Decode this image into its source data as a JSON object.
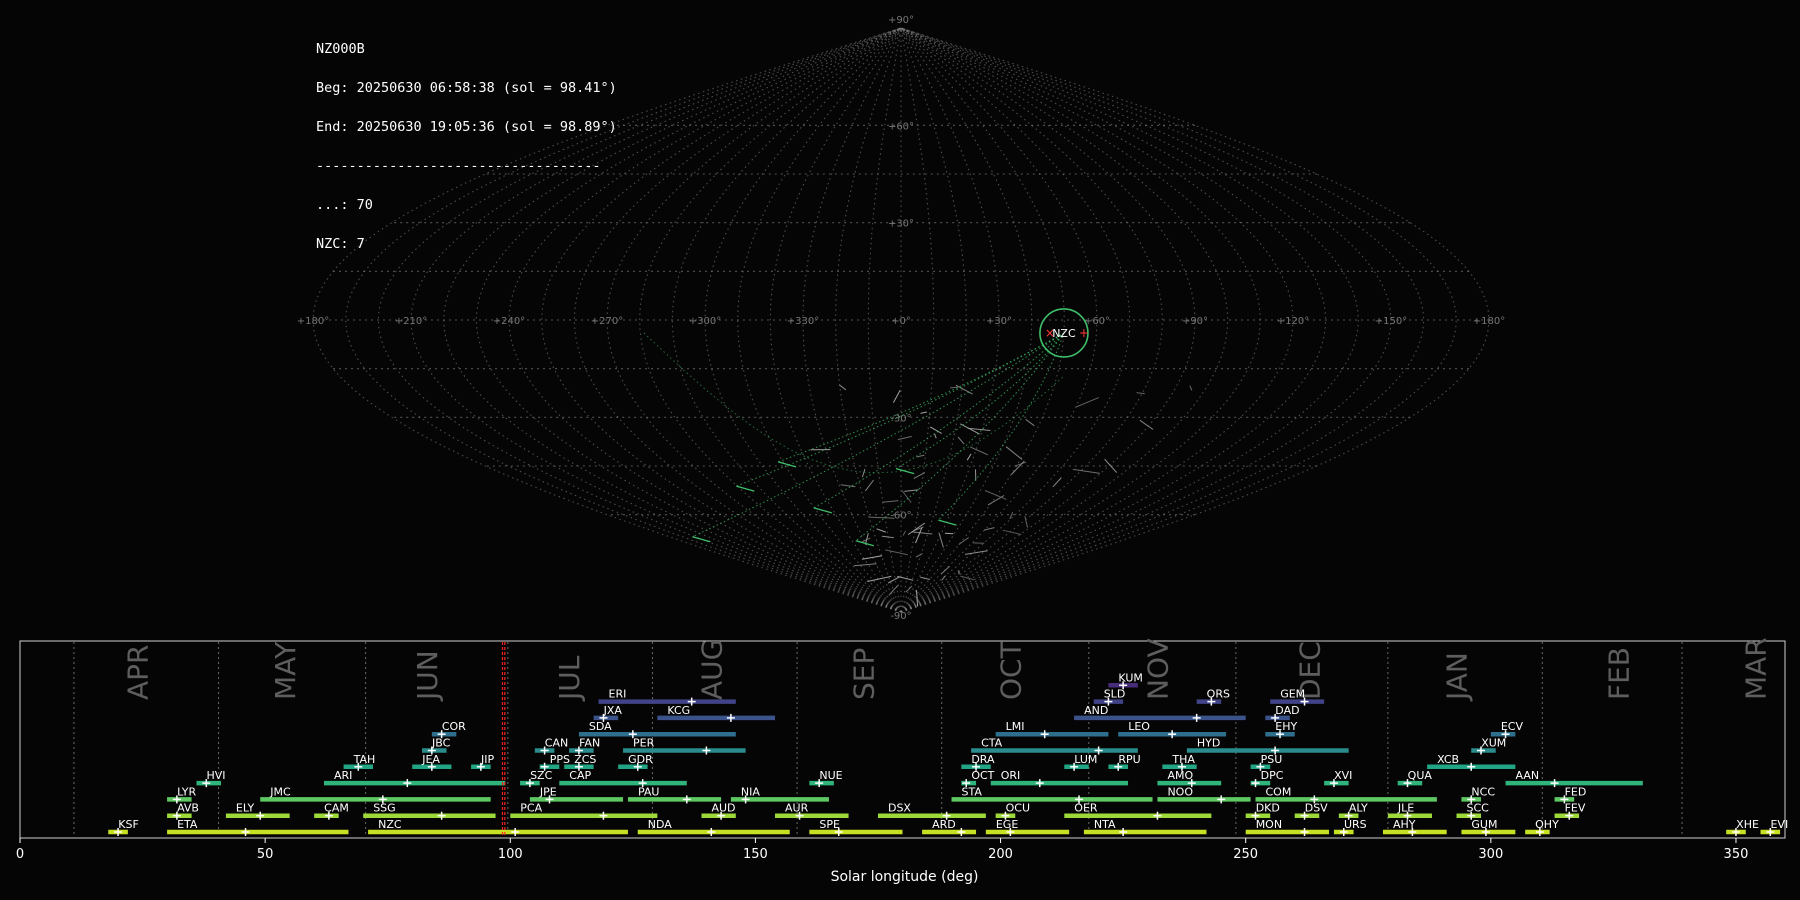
{
  "info": {
    "station": "NZ000B",
    "beg": "Beg: 20250630 06:58:38 (sol = 98.41°)",
    "end": "End: 20250630 19:05:36 (sol = 98.89°)",
    "separator": "-----------------------------------",
    "sporadic": "...: 70",
    "shower_count": "NZC: 7"
  },
  "colors": {
    "background": "#050505",
    "grid": "#888888",
    "radiant_circle": "#3fbf6a",
    "radiant_marker": "#ff3b3b",
    "solar_line": "#ff2020"
  },
  "chart_data": [
    {
      "type": "sky-map",
      "projection": "sinusoidal",
      "longitude_tick_labels": [
        "+180°",
        "+150°",
        "+120°",
        "+90°",
        "+60°",
        "+30°",
        "+0°",
        "+330°",
        "+300°",
        "+270°",
        "+240°",
        "+210°",
        "+180°"
      ],
      "latitude_tick_labels": [
        "+90°",
        "+60°",
        "+30°",
        "-30°",
        "-60°",
        "-90°"
      ],
      "active_radiant": {
        "name": "NZC",
        "lon_offset_deg": -50,
        "lat_deg": -4
      },
      "meteor_count_sporadic": 70,
      "meteor_count_shower": 7
    },
    {
      "type": "timeline",
      "xlabel": "Solar longitude (deg)",
      "xlim": [
        0,
        360
      ],
      "xticks": [
        0,
        50,
        100,
        150,
        200,
        250,
        300,
        350
      ],
      "current_sol": [
        98.41,
        98.89
      ],
      "months": [
        {
          "name": "APR",
          "at": 24
        },
        {
          "name": "MAY",
          "at": 54
        },
        {
          "name": "JUN",
          "at": 83
        },
        {
          "name": "JUL",
          "at": 112
        },
        {
          "name": "AUG",
          "at": 141
        },
        {
          "name": "SEP",
          "at": 172
        },
        {
          "name": "OCT",
          "at": 202
        },
        {
          "name": "NOV",
          "at": 232
        },
        {
          "name": "DEC",
          "at": 263
        },
        {
          "name": "JAN",
          "at": 293
        },
        {
          "name": "FEB",
          "at": 326
        },
        {
          "name": "MAR",
          "at": 354
        }
      ],
      "month_boundaries": [
        11,
        40.5,
        70.5,
        99.5,
        129,
        158.5,
        188,
        218,
        248,
        279,
        310.5,
        339
      ],
      "showers": [
        {
          "name": "KUM",
          "start": 222,
          "end": 228,
          "peak": 225,
          "row": 9
        },
        {
          "name": "ERI",
          "start": 118,
          "end": 146,
          "peak": 137,
          "row": 8
        },
        {
          "name": "SLD",
          "start": 219,
          "end": 225,
          "peak": 222,
          "row": 8
        },
        {
          "name": "ORS",
          "start": 240,
          "end": 245,
          "peak": 243,
          "row": 8
        },
        {
          "name": "GEM",
          "start": 255,
          "end": 266,
          "peak": 262,
          "row": 8
        },
        {
          "name": "JXA",
          "start": 117,
          "end": 122,
          "peak": 119,
          "row": 7
        },
        {
          "name": "KCG",
          "start": 130,
          "end": 154,
          "peak": 145,
          "row": 7
        },
        {
          "name": "AND",
          "start": 215,
          "end": 250,
          "peak": 240,
          "row": 7
        },
        {
          "name": "DAD",
          "start": 254,
          "end": 259,
          "peak": 256,
          "row": 7
        },
        {
          "name": "COR",
          "start": 84,
          "end": 89,
          "peak": 86,
          "row": 6
        },
        {
          "name": "SDA",
          "start": 114,
          "end": 146,
          "peak": 125,
          "row": 6
        },
        {
          "name": "LMI",
          "start": 199,
          "end": 222,
          "peak": 209,
          "row": 6
        },
        {
          "name": "LEO",
          "start": 224,
          "end": 246,
          "peak": 235,
          "row": 6
        },
        {
          "name": "EHY",
          "start": 254,
          "end": 260,
          "peak": 257,
          "row": 6
        },
        {
          "name": "ECV",
          "start": 300,
          "end": 305,
          "peak": 303,
          "row": 6
        },
        {
          "name": "JBC",
          "start": 82,
          "end": 87,
          "peak": 84,
          "row": 5
        },
        {
          "name": "CAN",
          "start": 105,
          "end": 109,
          "peak": 107,
          "row": 5
        },
        {
          "name": "FAN",
          "start": 112,
          "end": 117,
          "peak": 114,
          "row": 5
        },
        {
          "name": "PER",
          "start": 123,
          "end": 148,
          "peak": 140,
          "row": 5
        },
        {
          "name": "CTA",
          "start": 194,
          "end": 228,
          "peak": 220,
          "row": 5
        },
        {
          "name": "HYD",
          "start": 238,
          "end": 271,
          "peak": 256,
          "row": 5
        },
        {
          "name": "XUM",
          "start": 296,
          "end": 301,
          "peak": 298,
          "row": 5
        },
        {
          "name": "TAH",
          "start": 66,
          "end": 72,
          "peak": 69,
          "row": 4
        },
        {
          "name": "JEA",
          "start": 80,
          "end": 88,
          "peak": 84,
          "row": 4
        },
        {
          "name": "JIP",
          "start": 92,
          "end": 96,
          "peak": 94,
          "row": 4
        },
        {
          "name": "PPS",
          "start": 106,
          "end": 110,
          "peak": 107,
          "row": 4
        },
        {
          "name": "ZCS",
          "start": 111,
          "end": 117,
          "peak": 114,
          "row": 4
        },
        {
          "name": "GDR",
          "start": 122,
          "end": 128,
          "peak": 126,
          "row": 4
        },
        {
          "name": "DRA",
          "start": 192,
          "end": 198,
          "peak": 195,
          "row": 4
        },
        {
          "name": "LUM",
          "start": 213,
          "end": 218,
          "peak": 215,
          "row": 4
        },
        {
          "name": "RPU",
          "start": 222,
          "end": 226,
          "peak": 224,
          "row": 4
        },
        {
          "name": "THA",
          "start": 233,
          "end": 240,
          "peak": 237,
          "row": 4
        },
        {
          "name": "PSU",
          "start": 251,
          "end": 255,
          "peak": 253,
          "row": 4
        },
        {
          "name": "XCB",
          "start": 287,
          "end": 305,
          "peak": 296,
          "row": 4
        },
        {
          "name": "HVI",
          "start": 36,
          "end": 41,
          "peak": 38,
          "row": 3
        },
        {
          "name": "ARI",
          "start": 62,
          "end": 99,
          "peak": 79,
          "row": 3
        },
        {
          "name": "SZC",
          "start": 102,
          "end": 106,
          "peak": 104,
          "row": 3
        },
        {
          "name": "CAP",
          "start": 110,
          "end": 136,
          "peak": 127,
          "row": 3
        },
        {
          "name": "NUE",
          "start": 161,
          "end": 166,
          "peak": 163,
          "row": 3
        },
        {
          "name": "OCT",
          "start": 192,
          "end": 195,
          "peak": 193,
          "row": 3
        },
        {
          "name": "ORI",
          "start": 198,
          "end": 226,
          "peak": 208,
          "row": 3
        },
        {
          "name": "AMO",
          "start": 232,
          "end": 245,
          "peak": 239,
          "row": 3
        },
        {
          "name": "DPC",
          "start": 251,
          "end": 255,
          "peak": 252,
          "row": 3
        },
        {
          "name": "XVI",
          "start": 266,
          "end": 271,
          "peak": 268,
          "row": 3
        },
        {
          "name": "QUA",
          "start": 281,
          "end": 286,
          "peak": 283,
          "row": 3
        },
        {
          "name": "AAN",
          "start": 303,
          "end": 331,
          "peak": 313,
          "row": 3
        },
        {
          "name": "LYR",
          "start": 30,
          "end": 35,
          "peak": 32,
          "row": 2
        },
        {
          "name": "JMC",
          "start": 49,
          "end": 96,
          "peak": 74,
          "row": 2
        },
        {
          "name": "JPE",
          "start": 104,
          "end": 123,
          "peak": 108,
          "row": 2
        },
        {
          "name": "PAU",
          "start": 124,
          "end": 143,
          "peak": 136,
          "row": 2
        },
        {
          "name": "NIA",
          "start": 145,
          "end": 165,
          "peak": 148,
          "row": 2
        },
        {
          "name": "STA",
          "start": 190,
          "end": 231,
          "peak": 216,
          "row": 2
        },
        {
          "name": "NOO",
          "start": 232,
          "end": 251,
          "peak": 245,
          "row": 2
        },
        {
          "name": "COM",
          "start": 252,
          "end": 289,
          "peak": 264,
          "row": 2
        },
        {
          "name": "NCC",
          "start": 294,
          "end": 298,
          "peak": 296,
          "row": 2
        },
        {
          "name": "FED",
          "start": 313,
          "end": 317,
          "peak": 315,
          "row": 2
        },
        {
          "name": "AVB",
          "start": 30,
          "end": 35,
          "peak": 32,
          "row": 1
        },
        {
          "name": "ELY",
          "start": 42,
          "end": 55,
          "peak": 49,
          "row": 1
        },
        {
          "name": "CAM",
          "start": 60,
          "end": 65,
          "peak": 63,
          "row": 1
        },
        {
          "name": "SSG",
          "start": 70,
          "end": 97,
          "peak": 86,
          "row": 1
        },
        {
          "name": "PCA",
          "start": 100,
          "end": 130,
          "peak": 119,
          "row": 1
        },
        {
          "name": "AUD",
          "start": 139,
          "end": 146,
          "peak": 143,
          "row": 1
        },
        {
          "name": "AUR",
          "start": 154,
          "end": 169,
          "peak": 159,
          "row": 1
        },
        {
          "name": "DSX",
          "start": 175,
          "end": 197,
          "peak": 189,
          "row": 1
        },
        {
          "name": "OCU",
          "start": 199,
          "end": 203,
          "peak": 201,
          "row": 1
        },
        {
          "name": "OER",
          "start": 213,
          "end": 243,
          "peak": 232,
          "row": 1
        },
        {
          "name": "DKD",
          "start": 250,
          "end": 255,
          "peak": 252,
          "row": 1
        },
        {
          "name": "DSV",
          "start": 260,
          "end": 265,
          "peak": 262,
          "row": 1
        },
        {
          "name": "ALY",
          "start": 269,
          "end": 273,
          "peak": 271,
          "row": 1
        },
        {
          "name": "JLE",
          "start": 279,
          "end": 288,
          "peak": 283,
          "row": 1
        },
        {
          "name": "SCC",
          "start": 293,
          "end": 298,
          "peak": 296,
          "row": 1
        },
        {
          "name": "FEV",
          "start": 313,
          "end": 318,
          "peak": 316,
          "row": 1
        },
        {
          "name": "KSF",
          "start": 18,
          "end": 22,
          "peak": 20,
          "row": 0
        },
        {
          "name": "ETA",
          "start": 30,
          "end": 67,
          "peak": 46,
          "row": 0
        },
        {
          "name": "NZC",
          "start": 71,
          "end": 124,
          "peak": 101,
          "row": 0
        },
        {
          "name": "NDA",
          "start": 126,
          "end": 157,
          "peak": 141,
          "row": 0
        },
        {
          "name": "SPE",
          "start": 161,
          "end": 180,
          "peak": 167,
          "row": 0
        },
        {
          "name": "ARD",
          "start": 184,
          "end": 195,
          "peak": 192,
          "row": 0
        },
        {
          "name": "EGE",
          "start": 197,
          "end": 214,
          "peak": 202,
          "row": 0
        },
        {
          "name": "NTA",
          "start": 217,
          "end": 242,
          "peak": 225,
          "row": 0
        },
        {
          "name": "MON",
          "start": 250,
          "end": 267,
          "peak": 262,
          "row": 0
        },
        {
          "name": "URS",
          "start": 268,
          "end": 272,
          "peak": 270,
          "row": 0
        },
        {
          "name": "AHY",
          "start": 278,
          "end": 291,
          "peak": 284,
          "row": 0
        },
        {
          "name": "GUM",
          "start": 294,
          "end": 305,
          "peak": 299,
          "row": 0
        },
        {
          "name": "OHY",
          "start": 307,
          "end": 312,
          "peak": 310,
          "row": 0
        },
        {
          "name": "XHE",
          "start": 348,
          "end": 352,
          "peak": 350,
          "row": 0
        },
        {
          "name": "EVI",
          "start": 355,
          "end": 359,
          "peak": 357,
          "row": 0
        }
      ]
    }
  ]
}
